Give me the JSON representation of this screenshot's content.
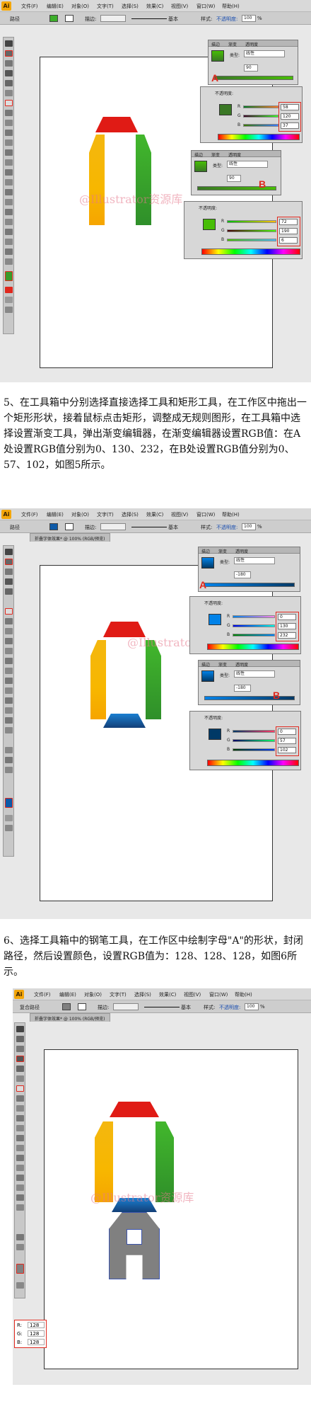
{
  "menu": {
    "logo": "Ai",
    "items": [
      "文件(F)",
      "编辑(E)",
      "对象(O)",
      "文字(T)",
      "选择(S)",
      "效果(C)",
      "视图(V)",
      "窗口(W)",
      "帮助(H)"
    ]
  },
  "shots": [
    {
      "ctrl_mode": "路径",
      "stroke_label": "描边:",
      "line_label": "基本",
      "style_label": "样式:",
      "opacity_label": "不透明度:",
      "opacity_value": "100",
      "percent": "%"
    },
    {
      "ctrl_mode": "路径",
      "stroke_label": "描边:",
      "line_label": "基本",
      "style_label": "样式:",
      "opacity_label": "不透明度:",
      "opacity_value": "100",
      "percent": "%",
      "tab": "折叠字体效果* @ 100% (RGB/预览)"
    },
    {
      "ctrl_mode": "复合路径",
      "stroke_label": "描边:",
      "line_label": "基本",
      "style_label": "样式:",
      "opacity_label": "不透明度:",
      "opacity_value": "100",
      "percent": "%",
      "tab": "折叠字体效果* @ 100% (RGB/预览)"
    }
  ],
  "watermark": "@Illustrator资源库",
  "panels": {
    "gradient_tab": "渐变",
    "stroke_tab": "描边",
    "transparency_tab": "透明度",
    "type_label": "类型:",
    "type_value": "线性",
    "opacity_label": "不透明度:",
    "marker_a": "A",
    "marker_b": "B",
    "shot1": {
      "a_angle": "90",
      "a_rgb": [
        "58",
        "120",
        "37"
      ],
      "b_angle": "90",
      "b_rgb": [
        "72",
        "190",
        "6"
      ]
    },
    "shot2": {
      "a_angle": "-180",
      "a_rgb": [
        "0",
        "130",
        "232"
      ],
      "b_angle": "-180",
      "b_rgb": [
        "0",
        "57",
        "102"
      ]
    }
  },
  "colors": {
    "shot1_swatch_a": "#3a7825",
    "shot1_swatch_b": "#48be06",
    "shot2_swatch_a": "#0082e8",
    "shot2_swatch_b": "#003966",
    "glyph_gray": "#808080"
  },
  "steps": {
    "step5": "5、在工具箱中分别选择直接选择工具和矩形工具，在工作区中拖出一个矩形形状，接着鼠标点击矩形，调整成无规则图形，在工具箱中选择设置渐变工具，弹出渐变编辑器，在渐变编辑器设置RGB值：在A处设置RGB值分别为0、130、232，在B处设置RGB值分别为0、57、102，如图5所示。",
    "step6": "6、选择工具箱中的钢笔工具，在工作区中绘制字母\"A\"的形状，封闭路径，然后设置颜色，设置RGB值为：128、128、128，如图6所示。"
  },
  "rgb_panel": {
    "r_label": "R:",
    "g_label": "G:",
    "b_label": "B:",
    "r": "128",
    "g": "128",
    "b": "128"
  }
}
